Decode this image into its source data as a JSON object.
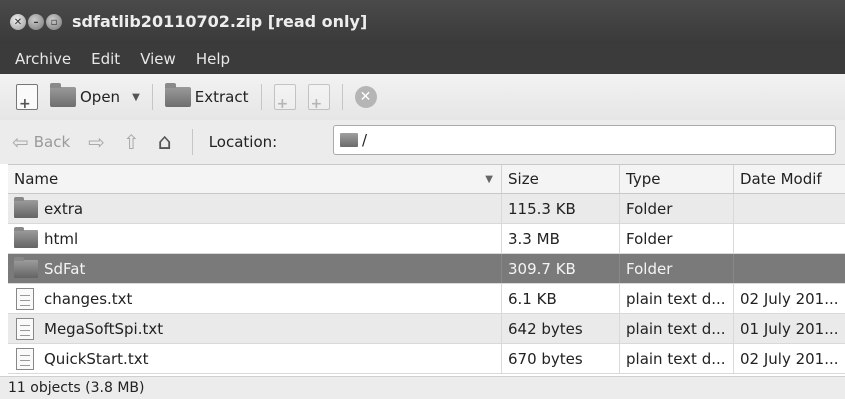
{
  "window": {
    "title": "sdfatlib20110702.zip [read only]"
  },
  "menu": [
    "Archive",
    "Edit",
    "View",
    "Help"
  ],
  "toolbar": {
    "open_label": "Open",
    "extract_label": "Extract"
  },
  "nav": {
    "back_label": "Back",
    "location_label": "Location:",
    "location_value": "/"
  },
  "table": {
    "columns": [
      "Name",
      "Size",
      "Type",
      "Date Modif"
    ],
    "rows": [
      {
        "name": "extra",
        "size": "115.3 KB",
        "type": "Folder",
        "date": "",
        "kind": "folder"
      },
      {
        "name": "html",
        "size": "3.3 MB",
        "type": "Folder",
        "date": "",
        "kind": "folder"
      },
      {
        "name": "SdFat",
        "size": "309.7 KB",
        "type": "Folder",
        "date": "",
        "kind": "folder",
        "selected": true
      },
      {
        "name": "changes.txt",
        "size": "6.1 KB",
        "type": "plain text d...",
        "date": "02 July 201...",
        "kind": "text"
      },
      {
        "name": "MegaSoftSpi.txt",
        "size": "642 bytes",
        "type": "plain text d...",
        "date": "01 July 201...",
        "kind": "text"
      },
      {
        "name": "QuickStart.txt",
        "size": "670 bytes",
        "type": "plain text d...",
        "date": "02 July 201...",
        "kind": "text"
      }
    ]
  },
  "status": {
    "text": "11 objects (3.8 MB)"
  }
}
